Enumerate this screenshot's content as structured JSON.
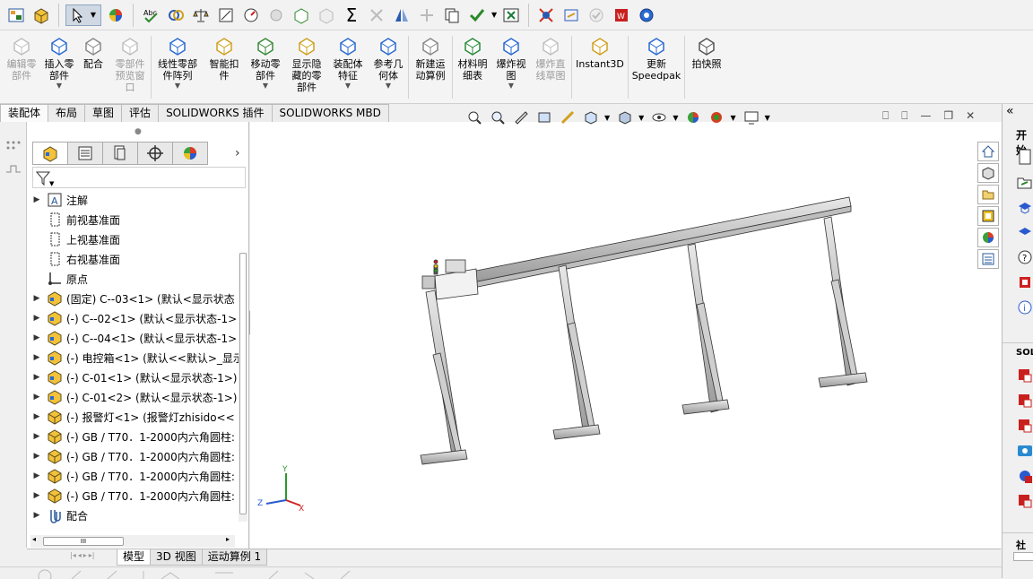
{
  "command_manager": {
    "buttons": [
      {
        "label": "编辑零\n部件",
        "disabled": true,
        "dropdown": false,
        "width": 44
      },
      {
        "label": "插入零\n部件",
        "disabled": false,
        "dropdown": true,
        "width": 40
      },
      {
        "label": "配合",
        "disabled": false,
        "dropdown": false,
        "width": 36
      },
      {
        "label": "零部件\n预览窗\n口",
        "disabled": true,
        "dropdown": false,
        "width": 46
      },
      {
        "label": "线性零部\n件阵列",
        "disabled": false,
        "dropdown": true,
        "width": 58
      },
      {
        "label": "智能扣\n件",
        "disabled": false,
        "dropdown": false,
        "width": 46
      },
      {
        "label": "移动零\n部件",
        "disabled": false,
        "dropdown": true,
        "width": 46
      },
      {
        "label": "显示隐\n藏的零\n部件",
        "disabled": false,
        "dropdown": false,
        "width": 46
      },
      {
        "label": "装配体\n特征",
        "disabled": false,
        "dropdown": true,
        "width": 46
      },
      {
        "label": "参考几\n何体",
        "disabled": false,
        "dropdown": true,
        "width": 44
      },
      {
        "label": "新建运\n动算例",
        "disabled": false,
        "dropdown": false,
        "width": 48
      },
      {
        "label": "材料明\n细表",
        "disabled": false,
        "dropdown": false,
        "width": 44
      },
      {
        "label": "爆炸视\n图",
        "disabled": false,
        "dropdown": true,
        "width": 42
      },
      {
        "label": "爆炸直\n线草图",
        "disabled": true,
        "dropdown": false,
        "width": 46
      },
      {
        "label": "Instant3D",
        "disabled": false,
        "dropdown": false,
        "width": 62
      },
      {
        "label": "更新\nSpeedpak",
        "disabled": false,
        "dropdown": false,
        "width": 62
      },
      {
        "label": "拍快照",
        "disabled": false,
        "dropdown": false,
        "width": 48
      }
    ]
  },
  "tabs": [
    "装配体",
    "布局",
    "草图",
    "评估",
    "SOLIDWORKS 插件",
    "SOLIDWORKS MBD"
  ],
  "tree": [
    {
      "label": "注解",
      "arrow": true,
      "icon": "annotation-icon",
      "indent": 0
    },
    {
      "label": "前视基准面",
      "arrow": false,
      "icon": "plane-icon",
      "indent": 0
    },
    {
      "label": "上视基准面",
      "arrow": false,
      "icon": "plane-icon",
      "indent": 0
    },
    {
      "label": "右视基准面",
      "arrow": false,
      "icon": "plane-icon",
      "indent": 0
    },
    {
      "label": "原点",
      "arrow": false,
      "icon": "origin-icon",
      "indent": 0
    },
    {
      "label": "(固定) C--03<1> (默认<显示状态",
      "arrow": true,
      "icon": "part-icon",
      "indent": 0
    },
    {
      "label": "(-) C--02<1> (默认<显示状态-1>",
      "arrow": true,
      "icon": "part-icon",
      "indent": 0
    },
    {
      "label": "(-) C--04<1> (默认<显示状态-1>",
      "arrow": true,
      "icon": "part-icon",
      "indent": 0
    },
    {
      "label": "(-) 电控箱<1> (默认<<默认>_显示",
      "arrow": true,
      "icon": "part-icon",
      "indent": 0
    },
    {
      "label": "(-) C-01<1> (默认<显示状态-1>)",
      "arrow": true,
      "icon": "part-icon",
      "indent": 0
    },
    {
      "label": "(-) C-01<2> (默认<显示状态-1>)",
      "arrow": true,
      "icon": "part-icon",
      "indent": 0
    },
    {
      "label": "(-) 报警灯<1> (报警灯zhisido<<",
      "arrow": true,
      "icon": "subpart-icon",
      "indent": 0
    },
    {
      "label": "(-) GB / T70．1-2000内六角圆柱:",
      "arrow": true,
      "icon": "subpart-icon",
      "indent": 0
    },
    {
      "label": "(-) GB / T70．1-2000内六角圆柱:",
      "arrow": true,
      "icon": "subpart-icon",
      "indent": 0
    },
    {
      "label": "(-) GB / T70．1-2000内六角圆柱:",
      "arrow": true,
      "icon": "subpart-icon",
      "indent": 0
    },
    {
      "label": "(-) GB / T70．1-2000内六角圆柱:",
      "arrow": true,
      "icon": "subpart-icon",
      "indent": 0
    },
    {
      "label": "配合",
      "arrow": true,
      "icon": "mates-icon",
      "indent": 0
    }
  ],
  "bottom_tabs": [
    "模型",
    "3D 视图",
    "运动算例 1"
  ],
  "task_pane": {
    "header": "开始",
    "section": "SOLI",
    "footer": "社"
  },
  "scroll_label": "III",
  "triad": {
    "x": "X",
    "y": "Y",
    "z": "Z"
  }
}
